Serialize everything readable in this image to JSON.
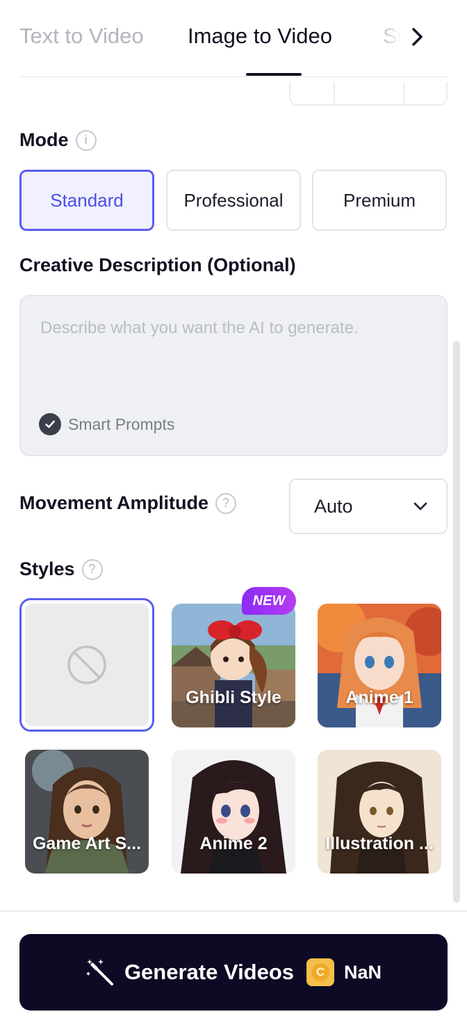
{
  "tabs": {
    "items": [
      {
        "label": "Text to Video",
        "active": false
      },
      {
        "label": "Image to Video",
        "active": true
      },
      {
        "label": "Su",
        "active": false
      }
    ],
    "next_icon": "chevron-right-icon"
  },
  "mode": {
    "title": "Mode",
    "info_icon": "info-icon",
    "options": [
      {
        "label": "Standard",
        "selected": true
      },
      {
        "label": "Professional",
        "selected": false
      },
      {
        "label": "Premium",
        "selected": false
      }
    ]
  },
  "description": {
    "title": "Creative Description (Optional)",
    "placeholder": "Describe what you want the AI to generate.",
    "value": "",
    "smart_prompts_label": "Smart Prompts",
    "smart_prompts_checked": true
  },
  "movement": {
    "label": "Movement Amplitude",
    "help_icon": "help-icon",
    "selected": "Auto"
  },
  "styles": {
    "title": "Styles",
    "help_icon": "help-icon",
    "items": [
      {
        "label": "",
        "type": "none",
        "selected": true
      },
      {
        "label": "Ghibli Style",
        "badge": "NEW"
      },
      {
        "label": "Anime 1"
      },
      {
        "label": "Game Art S..."
      },
      {
        "label": "Anime 2"
      },
      {
        "label": "Illustration ..."
      }
    ]
  },
  "footer": {
    "generate_label": "Generate Videos",
    "cost": "NaN",
    "coin_letter": "C"
  },
  "colors": {
    "accent": "#5b5ef0",
    "button_dark": "#0c0a24",
    "badge": "#9b30f3"
  }
}
